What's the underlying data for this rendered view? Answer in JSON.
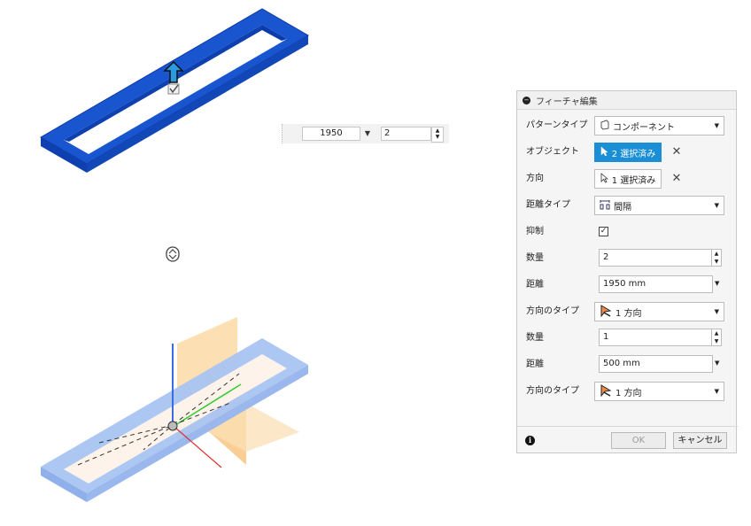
{
  "float_input": {
    "distance_value": "1950",
    "quantity_value": "2"
  },
  "dialog": {
    "title": "フィーチャ編集",
    "pattern_type_label": "パターンタイプ",
    "pattern_type_value": "コンポーネント",
    "object_label": "オブジェクト",
    "object_value": "2 選択済み",
    "direction_label": "方向",
    "direction_value": "1 選択済み",
    "distance_type_label": "距離タイプ",
    "distance_type_value": "間隔",
    "suppress_label": "抑制",
    "suppress_checked": true,
    "quantity1_label": "数量",
    "quantity1_value": "2",
    "distance1_label": "距離",
    "distance1_value": "1950 mm",
    "direction_type1_label": "方向のタイプ",
    "direction_type1_value": "1 方向",
    "quantity2_label": "数量",
    "quantity2_value": "1",
    "distance2_label": "距離",
    "distance2_value": "500 mm",
    "direction_type2_label": "方向のタイプ",
    "direction_type2_value": "1 方向",
    "ok_label": "OK",
    "cancel_label": "キャンセル"
  },
  "colors": {
    "selected_frame": "#1650c8",
    "preview_frame": "#8fb2ee",
    "plane": "#f8b860",
    "active_button": "#1b8fd6"
  }
}
